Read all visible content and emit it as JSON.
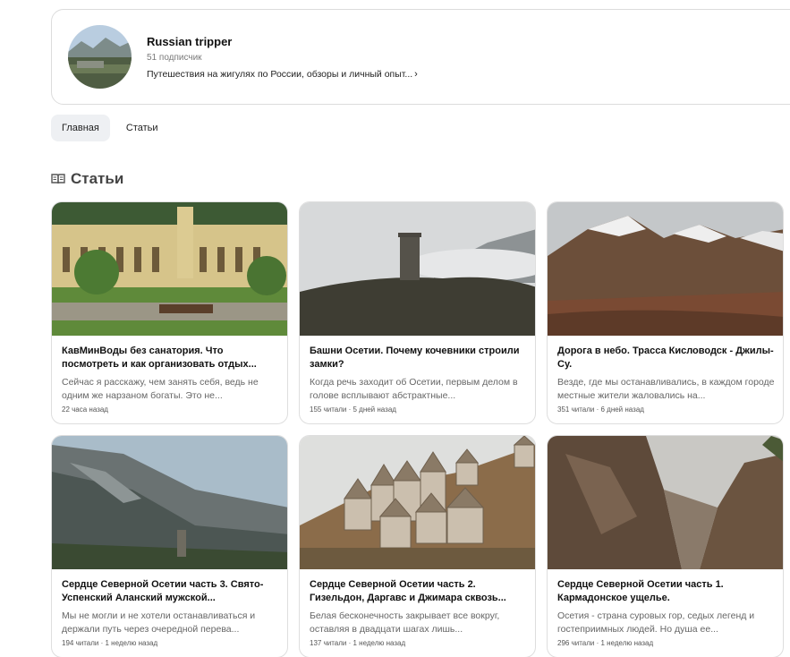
{
  "channel": {
    "name": "Russian tripper",
    "subscribers": "51 подписчик",
    "description": "Путешествия на жигулях по России, обзоры и личный опыт..."
  },
  "tabs": [
    {
      "label": "Главная",
      "active": true
    },
    {
      "label": "Статьи",
      "active": false
    }
  ],
  "section": {
    "title": "Статьи",
    "icon": "book-icon"
  },
  "articles": [
    {
      "title": "КавМинВоды без санатория. Что посмотреть и как организовать отдых...",
      "excerpt": "Сейчас я расскажу, чем занять себя, ведь не одним же нарзаном богаты. Это не...",
      "meta": "22 часа назад"
    },
    {
      "title": "Башни Осетии. Почему кочевники строили замки?",
      "excerpt": "Когда речь заходит об Осетии, первым делом в голове всплывают абстрактные...",
      "meta": "155 читали · 5 дней назад"
    },
    {
      "title": "Дорога в небо. Трасса Кисловодск - Джилы-Су.",
      "excerpt": "Везде, где мы останавливались, в каждом городе местные жители жаловались на...",
      "meta": "351 читали · 6 дней назад"
    },
    {
      "title": "Сердце Северной Осетии часть 3. Свято-Успенский Аланский мужской...",
      "excerpt": "Мы не могли и не хотели останавливаться и держали путь через очередной перева...",
      "meta": "194 читали · 1 неделю назад"
    },
    {
      "title": "Сердце Северной Осетии часть 2. Гизельдон, Даргавс и Джимара сквозь...",
      "excerpt": "Белая бесконечность закрывает все вокруг, оставляя в двадцати шагах лишь...",
      "meta": "137 читали · 1 неделю назад"
    },
    {
      "title": "Сердце Северной Осетии часть 1. Кармадонское ущелье.",
      "excerpt": "Осетия - страна суровых гор, седых легенд и гостеприимных людей. Но душа ее...",
      "meta": "296 читали · 1 неделю назад"
    }
  ]
}
